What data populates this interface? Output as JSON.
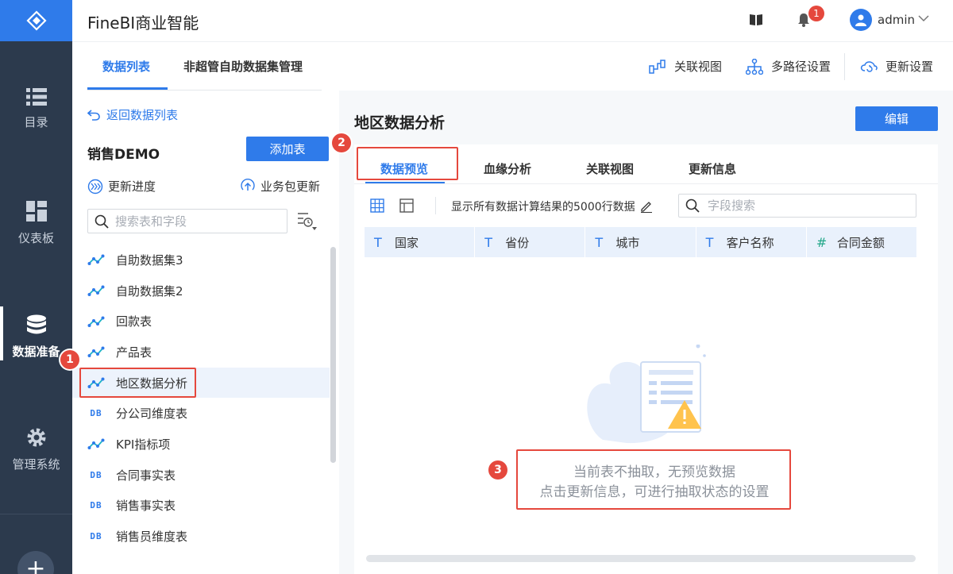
{
  "app": {
    "title": "FineBI商业智能"
  },
  "topbar": {
    "notification_count": "1",
    "username": "admin"
  },
  "nav": {
    "items": [
      {
        "label": "目录",
        "icon": "list-icon",
        "active": false
      },
      {
        "label": "仪表板",
        "icon": "dashboard-icon",
        "active": false
      },
      {
        "label": "数据准备",
        "icon": "database-icon",
        "active": true
      },
      {
        "label": "管理系统",
        "icon": "gear-icon",
        "active": false
      }
    ],
    "plus_label": "+"
  },
  "subbar": {
    "tabs": [
      "数据列表",
      "非超管自助数据集管理"
    ],
    "active_tab": "数据列表",
    "tools": [
      "关联视图",
      "多路径设置",
      "更新设置"
    ]
  },
  "left_panel": {
    "back_label": "返回数据列表",
    "package_title": "销售DEMO",
    "add_table_label": "添加表",
    "update_progress_label": "更新进度",
    "package_update_label": "业务包更新",
    "search_placeholder": "搜索表和字段",
    "tables": [
      {
        "name": "自助数据集3",
        "type": "selfhelp"
      },
      {
        "name": "自助数据集2",
        "type": "selfhelp"
      },
      {
        "name": "回款表",
        "type": "selfhelp"
      },
      {
        "name": "产品表",
        "type": "selfhelp"
      },
      {
        "name": "地区数据分析",
        "type": "selfhelp",
        "selected": true
      },
      {
        "name": "分公司维度表",
        "type": "db"
      },
      {
        "name": "KPI指标项",
        "type": "selfhelp"
      },
      {
        "name": "合同事实表",
        "type": "db"
      },
      {
        "name": "销售事实表",
        "type": "db"
      },
      {
        "name": "销售员维度表",
        "type": "db"
      }
    ],
    "db_tag": "DB"
  },
  "main": {
    "title": "地区数据分析",
    "edit_label": "编辑",
    "tabs": [
      "数据预览",
      "血缘分析",
      "关联视图",
      "更新信息"
    ],
    "active_tab": "数据预览",
    "rows_info": "显示所有数据计算结果的5000行数据",
    "field_search_placeholder": "字段搜索",
    "columns": [
      {
        "type": "T",
        "name": "国家"
      },
      {
        "type": "T",
        "name": "省份"
      },
      {
        "type": "T",
        "name": "城市"
      },
      {
        "type": "T",
        "name": "客户名称"
      },
      {
        "type": "#",
        "name": "合同金额"
      }
    ],
    "empty_line1": "当前表不抽取，无预览数据",
    "empty_line2": "点击更新信息，可进行抽取状态的设置"
  },
  "markers": [
    "1",
    "2",
    "3"
  ],
  "colors": {
    "accent": "#2f7bea",
    "nav_bg": "#2c3a4d",
    "marker": "#e5483d",
    "number_type": "#24a88a"
  }
}
